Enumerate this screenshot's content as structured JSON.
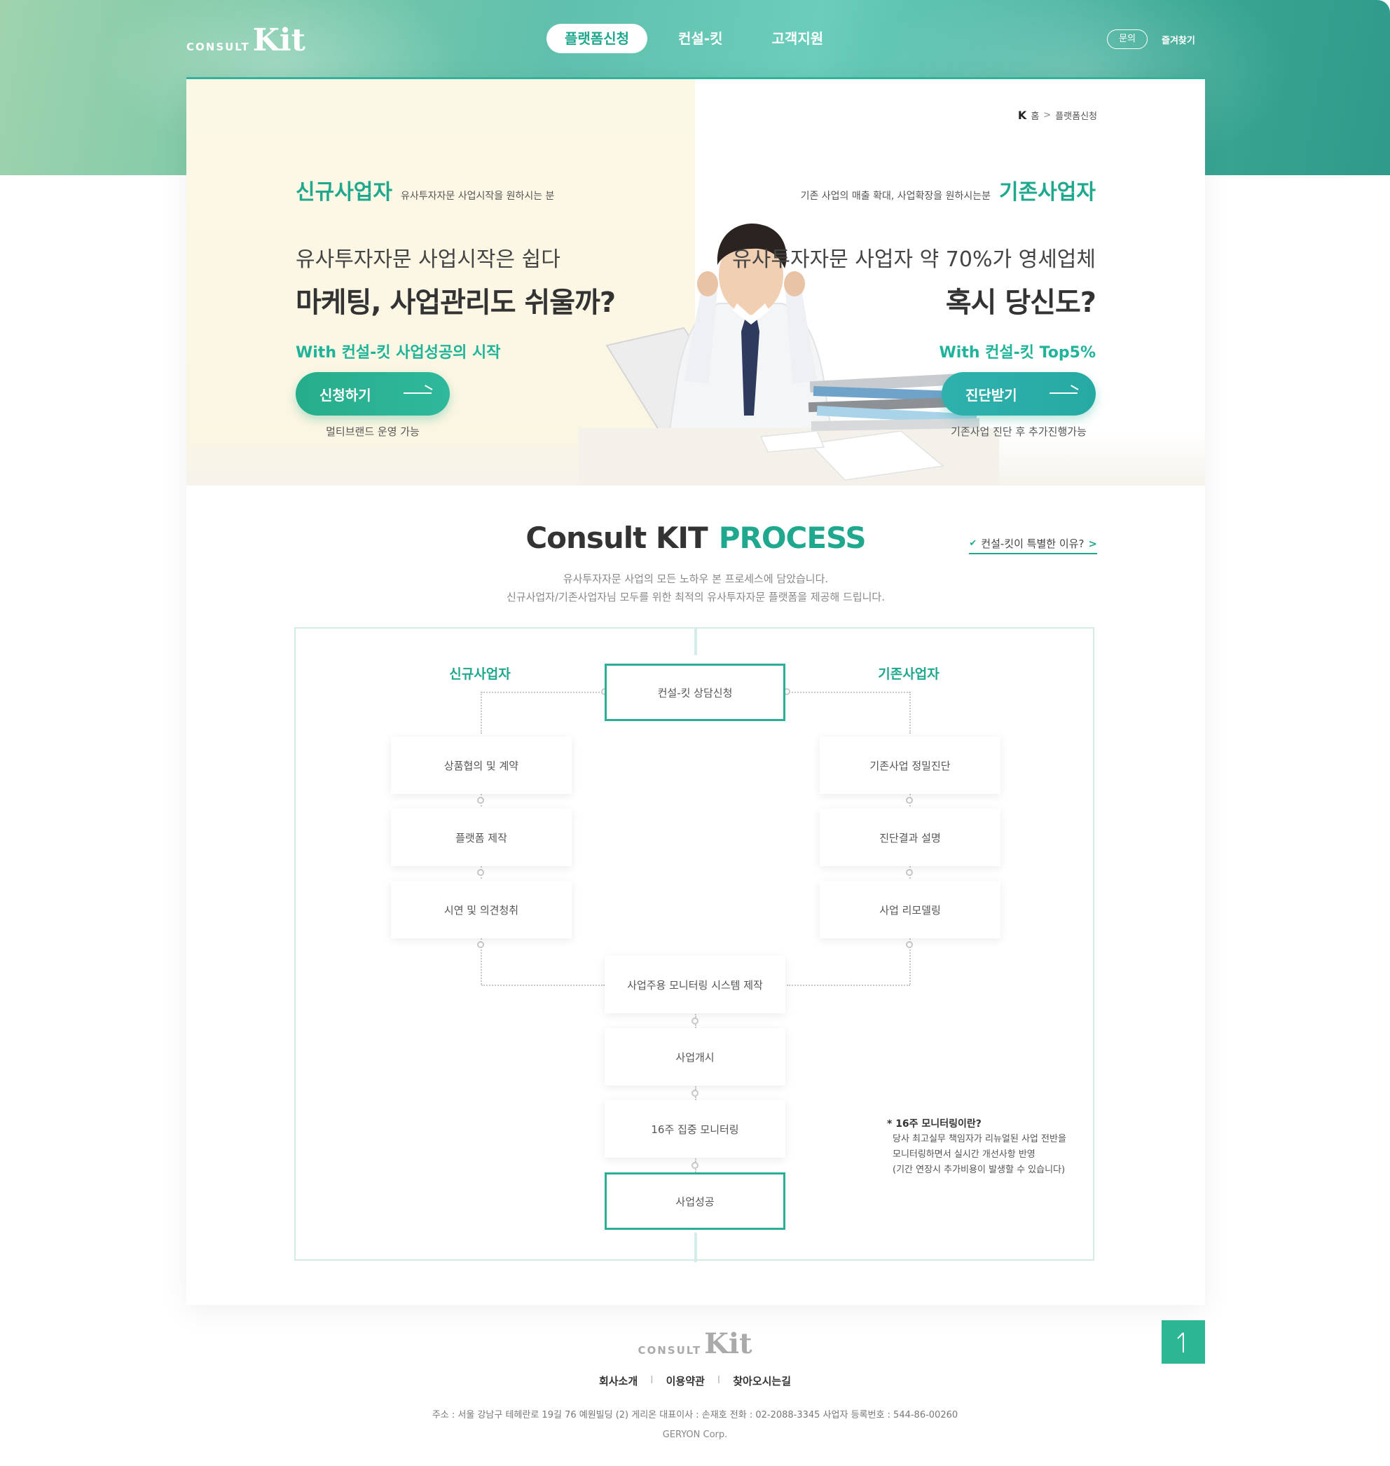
{
  "header": {
    "logo_small": "CONSULT",
    "logo_big": "Kit",
    "nav": [
      {
        "label": "플랫폼신청"
      },
      {
        "label": "컨설-킷"
      },
      {
        "label": "고객지원"
      }
    ],
    "util_inquiry": "문의",
    "util_favorite": "즐겨찾기"
  },
  "breadcrumb": {
    "home_icon": "K",
    "home": "홈",
    "sep": ">",
    "current": "플랫폼신청"
  },
  "hero": {
    "left": {
      "title": "신규사업자",
      "subtitle": "유사투자자문 사업시작을 원하시는 분",
      "line1": "유사투자자문 사업시작은 쉽다",
      "line2": "마케팅, 사업관리도 쉬울까?",
      "with": "With 컨설-킷 사업성공의 시작",
      "button": "신청하기",
      "note": "멀티브랜드 운영 가능"
    },
    "right": {
      "title": "기존사업자",
      "subtitle": "기존 사업의 매출 확대, 사업확장을 원하시는분",
      "line1": "유사투자자문 사업자 약 70%가 영세업체",
      "line2": "혹시 당신도?",
      "with": "With 컨설-킷 Top5%",
      "button": "진단받기",
      "note": "기존사업 진단 후 추가진행가능"
    }
  },
  "process": {
    "title_main": "Consult KIT",
    "title_accent": "PROCESS",
    "why_link": "컨설-킷이 특별한 이유?",
    "why_check": "✔",
    "why_gt": ">",
    "desc1": "유사투자자문 사업의 모든 노하우 본 프로세스에 담았습니다.",
    "desc2": "신규사업자/기존사업자님 모두를 위한 최적의 유사투자자문 플랫폼을 제공해 드립니다.",
    "left_label": "신규사업자",
    "right_label": "기존사업자",
    "start": "컨설-킷 상담신청",
    "left_steps": [
      "상품협의 및 계약",
      "플랫폼 제작",
      "시연 및 의견청취"
    ],
    "right_steps": [
      "기존사업 정밀진단",
      "진단결과 설명",
      "사업 리모델링"
    ],
    "center_steps": [
      "사업주용 모니터링 시스템 제작",
      "사업개시",
      "16주 집중 모니터링"
    ],
    "end": "사업성공",
    "note_title": "* 16주 모니터링이란?",
    "note_lines": [
      "당사 최고실무 책임자가 리뉴얼된 사업 전반을",
      "모니터링하면서 실시간 개선사항 반영",
      "(기간 연장시 추가비용이 발생할 수 있습니다)"
    ]
  },
  "footer": {
    "logo_small": "CONSULT",
    "logo_big": "Kit",
    "links": [
      "회사소개",
      "이용약관",
      "찾아오시는길"
    ],
    "link_sep": "I",
    "address": "주소 : 서울 강남구 테헤란로 19길 76 예원빌딩 (2) 게리온    대표이사 : 손재호    전화 : 02-2088-3345    사업자 등록번호 : 544-86-00260",
    "copyright": "GERYON Corp."
  },
  "colors": {
    "accent": "#1fa88e",
    "teal": "#2aae98",
    "hero_left_bg": "#fcf8e6"
  },
  "icons": {
    "top_button": "arrow-up-icon",
    "breadcrumb_home": "k-home-icon"
  }
}
